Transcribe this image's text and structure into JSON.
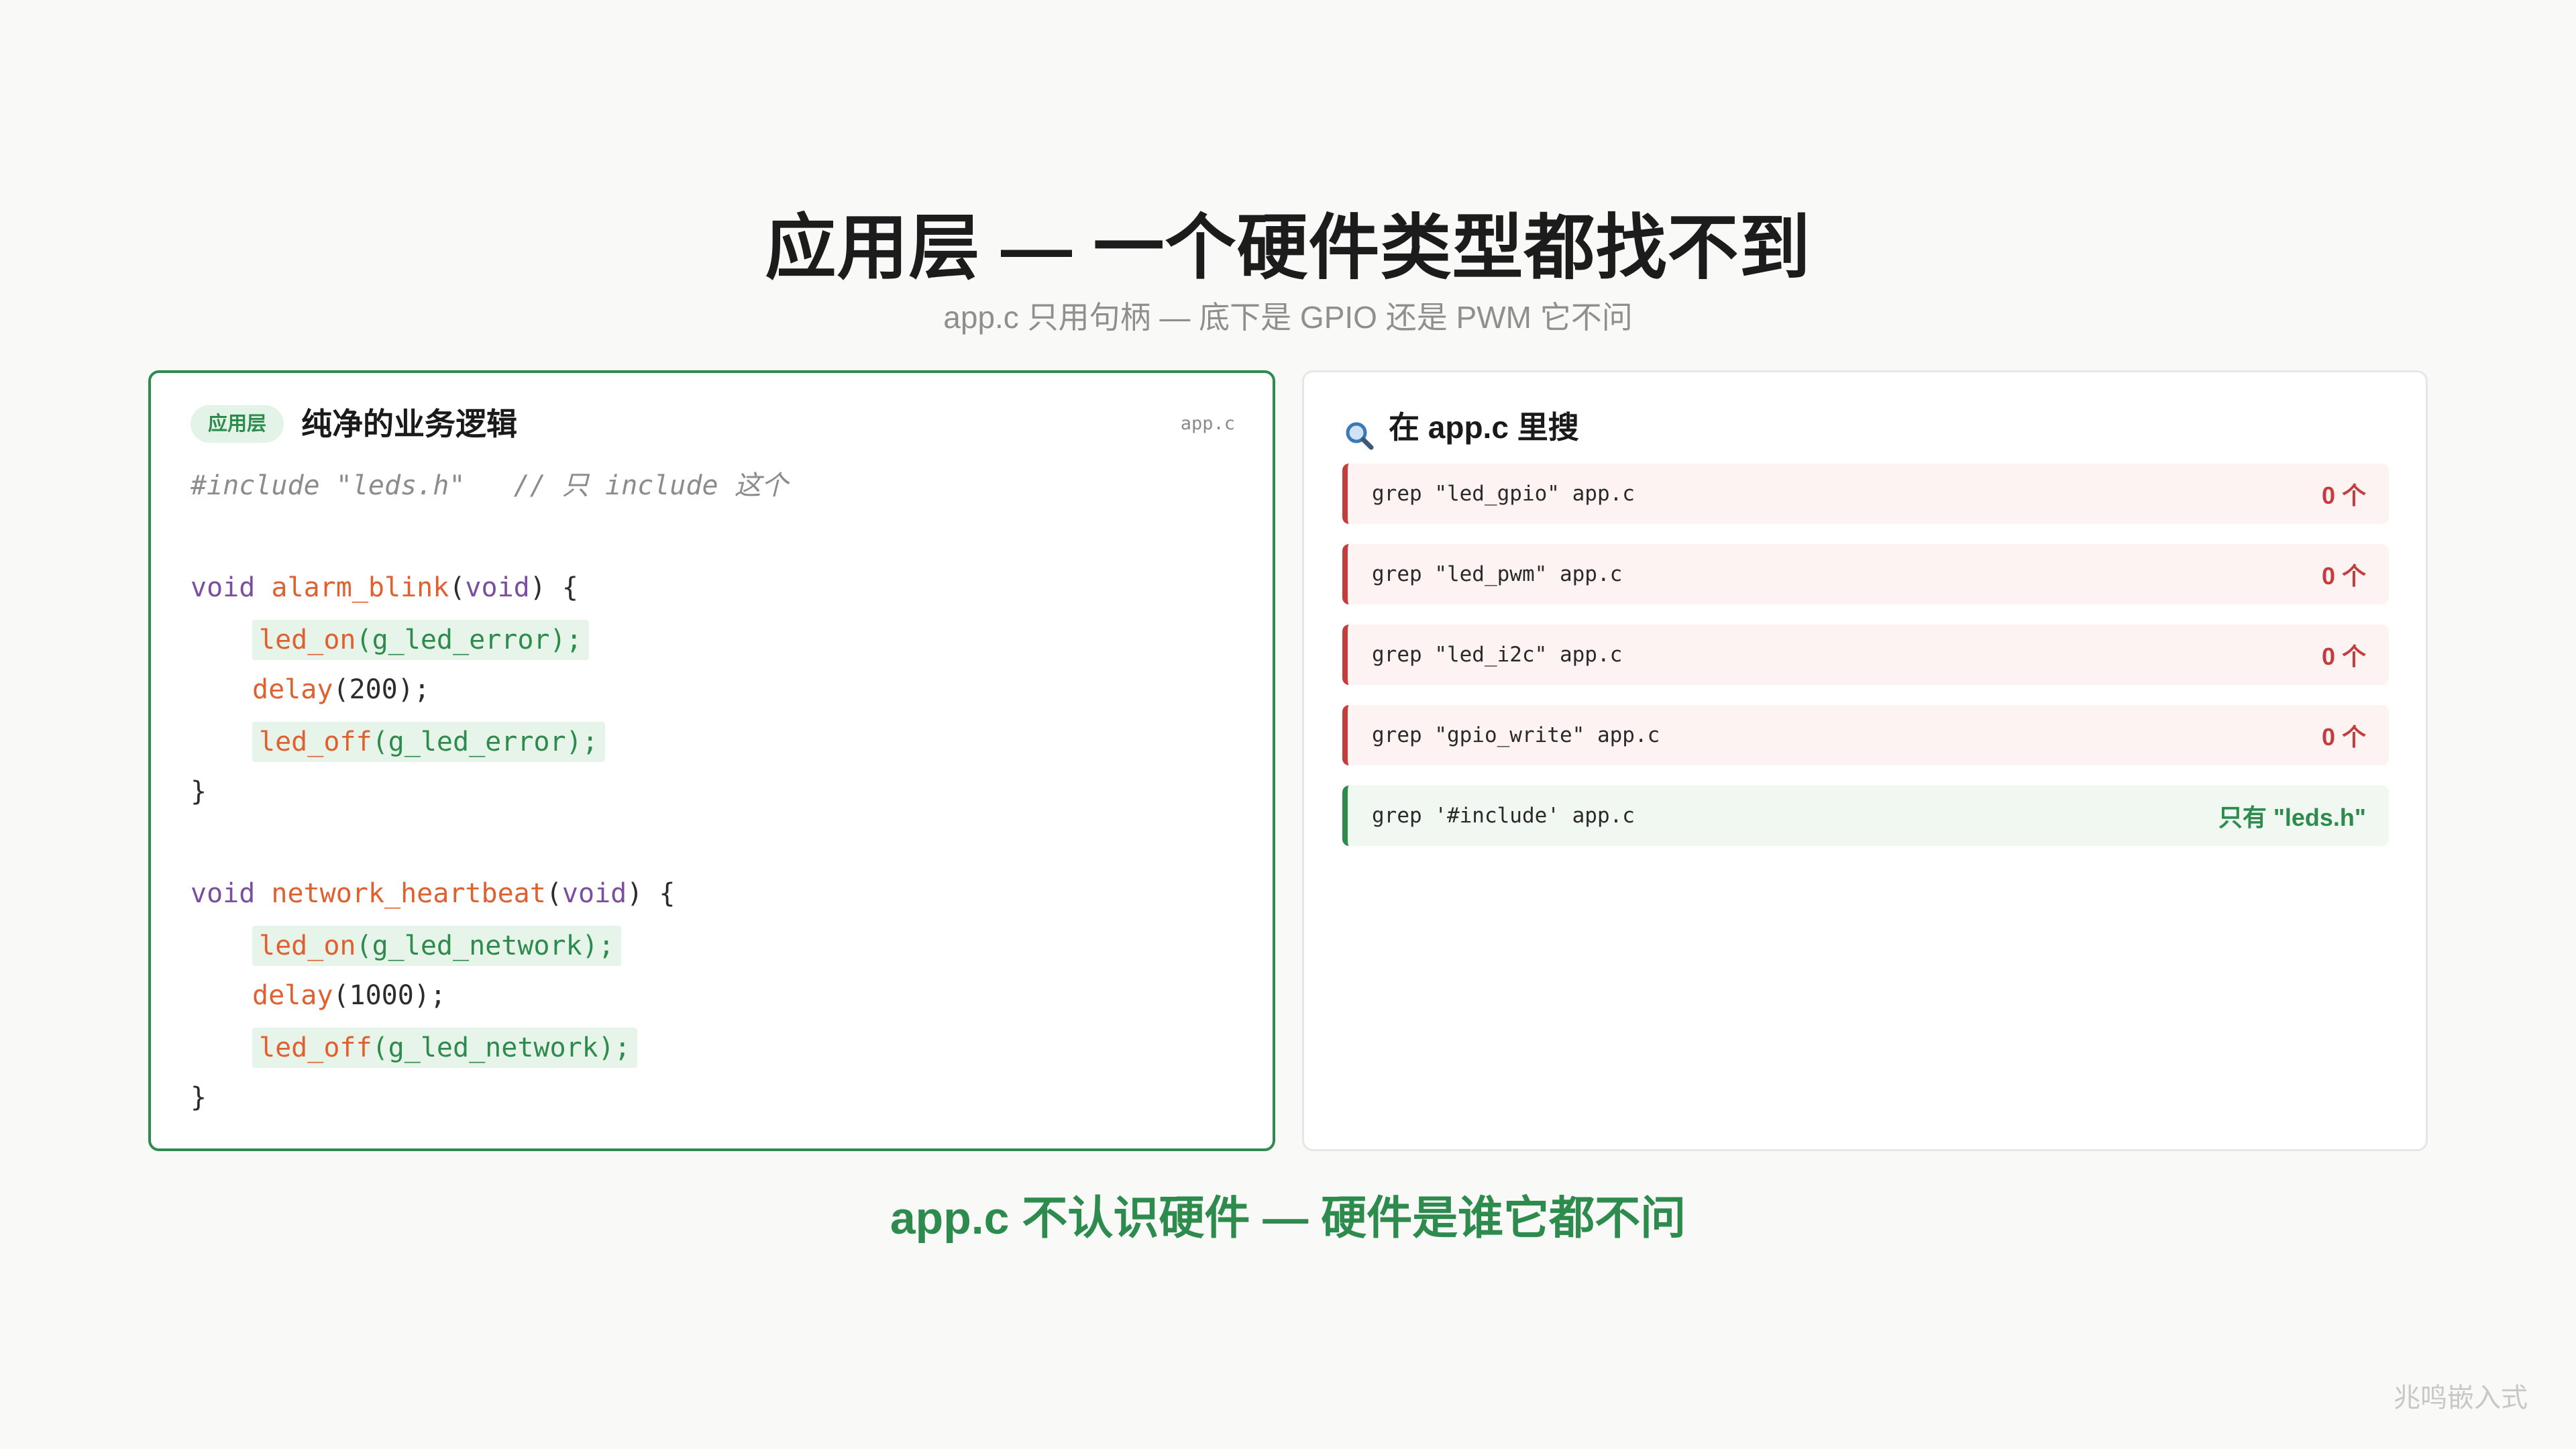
{
  "header": {
    "title": "应用层 — 一个硬件类型都找不到",
    "subtitle": "app.c 只用句柄 — 底下是 GPIO 还是 PWM 它不问"
  },
  "left_panel": {
    "badge": "应用层",
    "heading": "纯净的业务逻辑",
    "filename": "app.c",
    "code": {
      "include_directive": "#include \"leds.h\"",
      "include_comment": "// 只 include 这个",
      "fn1": {
        "ret": "void",
        "name": "alarm_blink",
        "params": "void",
        "open": ") {",
        "line1_fn": "led_on",
        "line1_arg": "(g_led_error);",
        "line2_fn": "delay",
        "line2_arg": "(200);",
        "line3_fn": "led_off",
        "line3_arg": "(g_led_error);",
        "close": "}"
      },
      "fn2": {
        "ret": "void",
        "name": "network_heartbeat",
        "params": "void",
        "open": ") {",
        "line1_fn": "led_on",
        "line1_arg": "(g_led_network);",
        "line2_fn": "delay",
        "line2_arg": "(1000);",
        "line3_fn": "led_off",
        "line3_arg": "(g_led_network);",
        "close": "}"
      }
    }
  },
  "right_panel": {
    "icon": "magnifier-icon",
    "heading": "在 app.c 里搜",
    "rows": [
      {
        "cmd": "grep \"led_gpio\" app.c",
        "result": "0 个",
        "status": "bad"
      },
      {
        "cmd": "grep \"led_pwm\" app.c",
        "result": "0 个",
        "status": "bad"
      },
      {
        "cmd": "grep \"led_i2c\" app.c",
        "result": "0 个",
        "status": "bad"
      },
      {
        "cmd": "grep \"gpio_write\" app.c",
        "result": "0 个",
        "status": "bad"
      },
      {
        "cmd": "grep '#include' app.c",
        "result": "只有 \"leds.h\"",
        "status": "good"
      }
    ]
  },
  "footer": {
    "caption": "app.c 不认识硬件 — 硬件是谁它都不问",
    "watermark": "兆鸣嵌入式"
  },
  "colors": {
    "accent_green": "#2e8b4e",
    "alert_red": "#c43c3c",
    "keyword_purple": "#7b4fa0",
    "function_orange": "#e06030"
  }
}
